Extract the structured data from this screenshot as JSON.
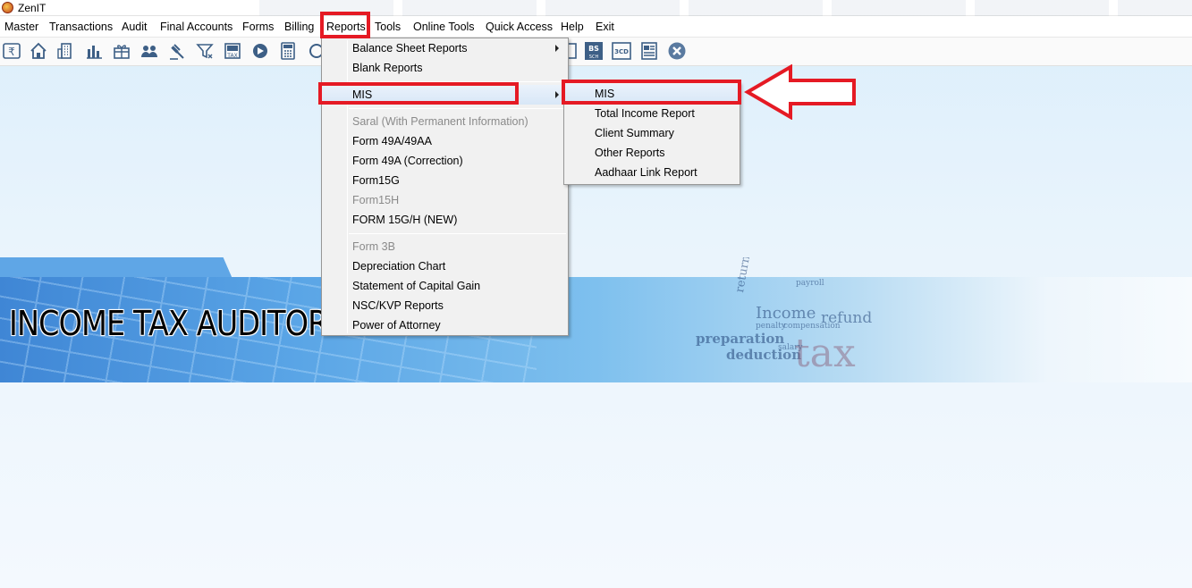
{
  "window": {
    "title": "ZenIT"
  },
  "menubar": [
    {
      "label": "Master",
      "key": "master"
    },
    {
      "label": "Transactions",
      "key": "transactions"
    },
    {
      "label": "Audit",
      "key": "audit"
    },
    {
      "label": "Final Accounts",
      "key": "final-accounts"
    },
    {
      "label": "Forms",
      "key": "forms"
    },
    {
      "label": "Billing",
      "key": "billing"
    },
    {
      "label": "Reports",
      "key": "reports"
    },
    {
      "label": "Tools",
      "key": "tools"
    },
    {
      "label": "Online Tools",
      "key": "online-tools"
    },
    {
      "label": "Quick Access",
      "key": "quick-access"
    },
    {
      "label": "Help",
      "key": "help"
    },
    {
      "label": "Exit",
      "key": "exit"
    }
  ],
  "toolbar": [
    {
      "icon": "rupee-icon"
    },
    {
      "icon": "home-icon"
    },
    {
      "icon": "building-icon"
    },
    {
      "icon": "bar-chart-icon"
    },
    {
      "icon": "gift-icon"
    },
    {
      "icon": "users-icon"
    },
    {
      "icon": "gavel-icon"
    },
    {
      "icon": "filter-icon"
    },
    {
      "icon": "tax-icon",
      "text": "TAX"
    },
    {
      "icon": "disc-icon"
    },
    {
      "icon": "calculator-icon"
    },
    {
      "icon": "bs-sch-icon",
      "text": "BS",
      "subtext": "SCH"
    },
    {
      "icon": "3cd-icon",
      "text": "3CD"
    },
    {
      "icon": "form-icon"
    },
    {
      "icon": "close-icon"
    }
  ],
  "reports_menu": {
    "items": [
      {
        "label": "Balance Sheet Reports",
        "submenu": true,
        "disabled": false
      },
      {
        "label": "Blank Reports",
        "submenu": false,
        "disabled": false
      },
      {
        "separator": true
      },
      {
        "label": "MIS",
        "submenu": true,
        "disabled": false,
        "highlighted": true
      },
      {
        "separator": true
      },
      {
        "label": "Saral (With Permanent Information)",
        "submenu": false,
        "disabled": true
      },
      {
        "label": "Form 49A/49AA",
        "submenu": false,
        "disabled": false
      },
      {
        "label": "Form 49A (Correction)",
        "submenu": false,
        "disabled": false
      },
      {
        "label": "Form15G",
        "submenu": false,
        "disabled": false
      },
      {
        "label": "Form15H",
        "submenu": false,
        "disabled": true
      },
      {
        "label": "FORM 15G/H (NEW)",
        "submenu": false,
        "disabled": false
      },
      {
        "separator": true
      },
      {
        "label": "Form 3B",
        "submenu": false,
        "disabled": true
      },
      {
        "label": "Depreciation Chart",
        "submenu": false,
        "disabled": false
      },
      {
        "label": "Statement of Capital Gain",
        "submenu": false,
        "disabled": false
      },
      {
        "label": "NSC/KVP Reports",
        "submenu": false,
        "disabled": false
      },
      {
        "label": "Power of Attorney",
        "submenu": false,
        "disabled": false
      }
    ]
  },
  "mis_submenu": {
    "items": [
      {
        "label": "MIS",
        "highlighted": true
      },
      {
        "label": "Total Income Report"
      },
      {
        "label": "Client Summary"
      },
      {
        "label": "Other Reports"
      },
      {
        "label": "Aadhaar Link Report"
      }
    ]
  },
  "banner": {
    "title": "INCOME TAX AUDITOR",
    "words": [
      "Income",
      "refund",
      "preparation",
      "deduction",
      "tax",
      "return",
      "penalty",
      "salary",
      "payroll",
      "compensation"
    ]
  },
  "colors": {
    "highlight_red": "#e51a24",
    "banner_blue": "#3f86d5"
  }
}
